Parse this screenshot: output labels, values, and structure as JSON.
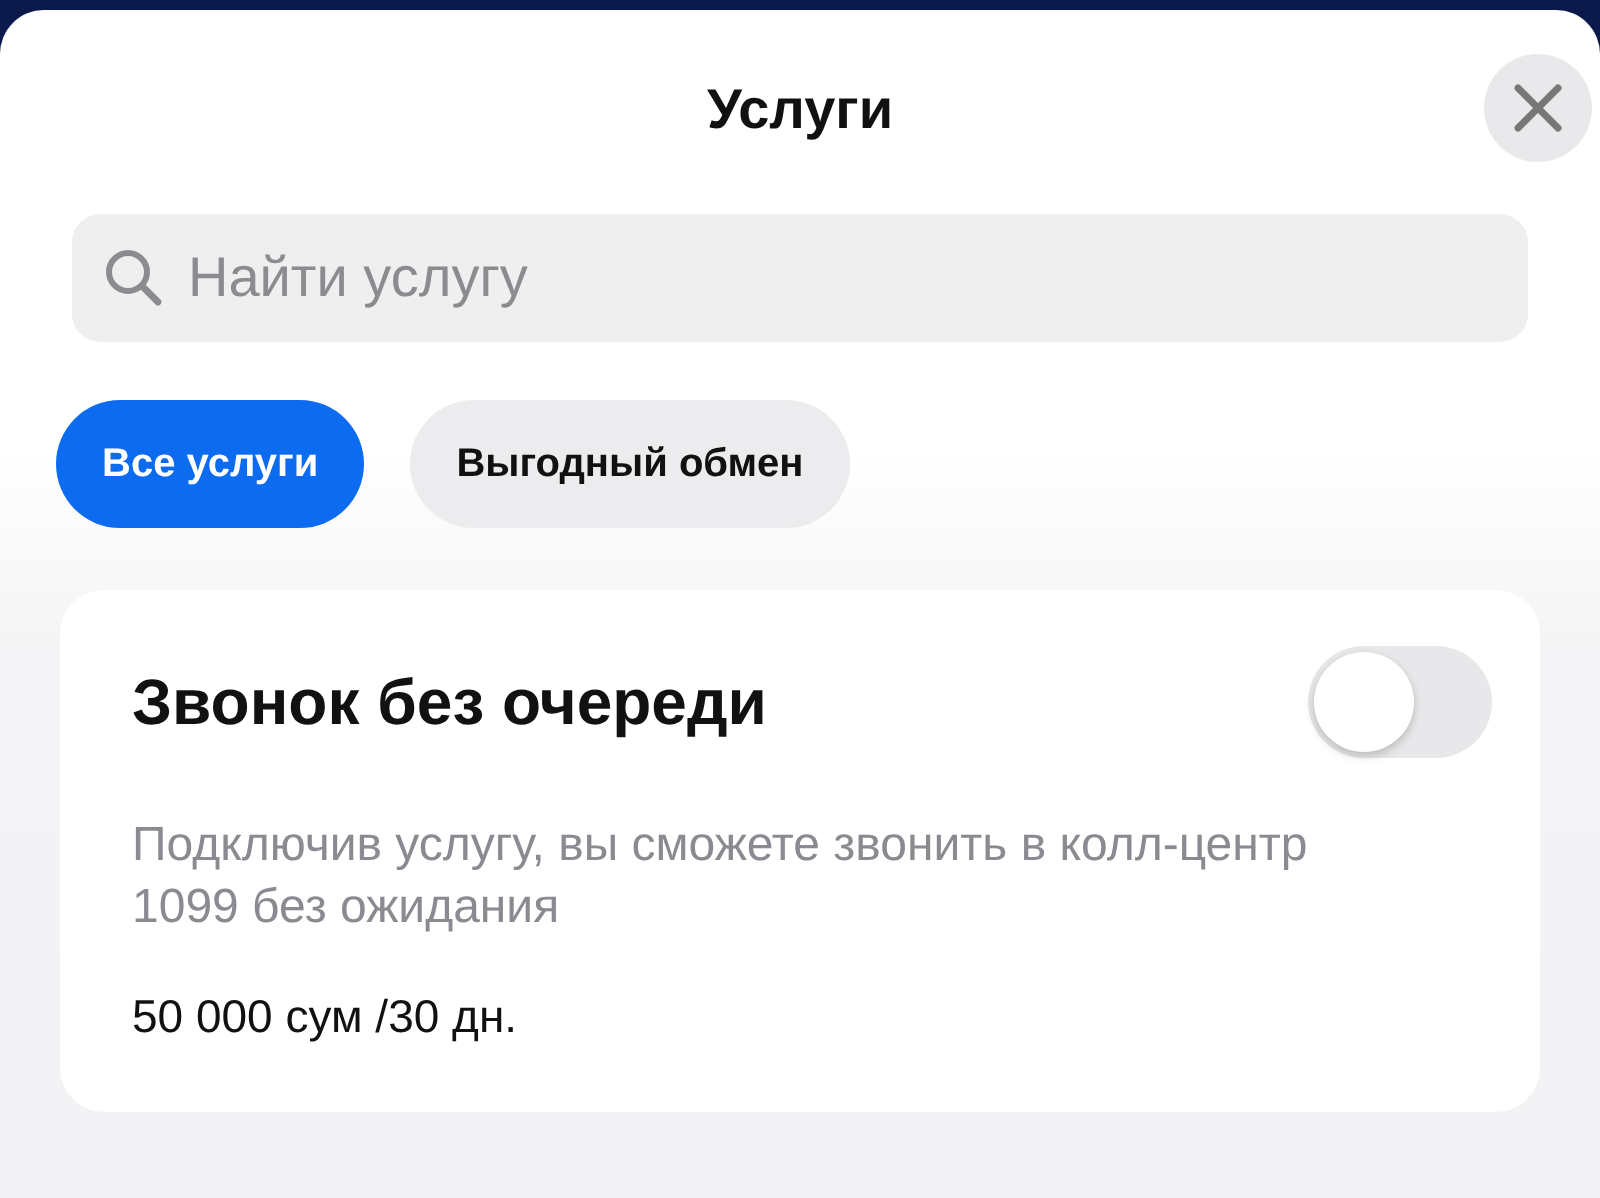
{
  "header": {
    "title": "Услуги"
  },
  "search": {
    "placeholder": "Найти услугу"
  },
  "filters": [
    {
      "label": "Все услуги",
      "selected": true
    },
    {
      "label": "Выгодный обмен",
      "selected": false
    }
  ],
  "services": [
    {
      "name": "Звонок без очереди",
      "on": false,
      "description": "Подключив услугу, вы сможете звонить в колл-центр 1099 без ожидания",
      "price": "50 000 сум /30 дн."
    }
  ]
}
